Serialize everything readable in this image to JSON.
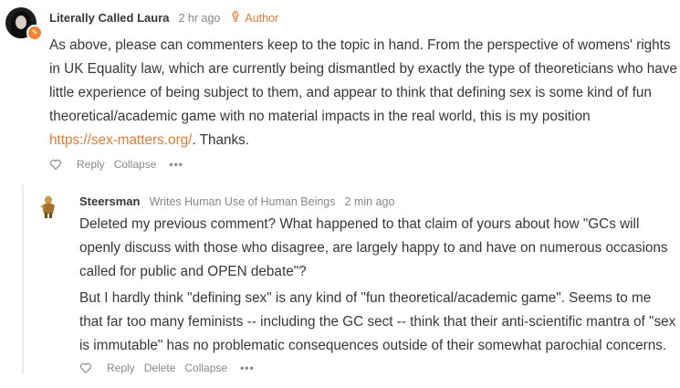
{
  "comment1": {
    "author": "Literally Called Laura",
    "time": "2 hr ago",
    "role_label": "Author",
    "paragraph1": "As above, please can commenters keep to the topic in hand. From the perspective of womens' rights in UK Equality law, which are currently being dismantled by exactly the type of theoreticians who have little experience of being subject to them, and appear to think that defining sex is some kind of fun theoretical/academic game with no material impacts in the real world, this is my position",
    "link": "https://sex-matters.org/",
    "link_suffix": ". Thanks.",
    "actions": {
      "reply": "Reply",
      "collapse": "Collapse",
      "more": "•••"
    }
  },
  "comment2": {
    "author": "Steersman",
    "subtitle": "Writes Human Use of Human Beings",
    "time": "2 min ago",
    "paragraph1": "Deleted my previous comment? What happened to that claim of yours about how \"GCs will openly discuss with those who disagree, are largely happy to and have on numerous occasions called for public and OPEN debate\"?",
    "paragraph2": "But I hardly think \"defining sex\" is any kind of \"fun theoretical/academic game\". Seems to me that far too many feminists -- including the GC sect -- think that their anti-scientific mantra of \"sex is immutable\" has no problematic consequences outside of their somewhat parochial concerns.",
    "actions": {
      "reply": "Reply",
      "delete": "Delete",
      "collapse": "Collapse",
      "more": "•••"
    }
  },
  "colors": {
    "accent": "#e07a33",
    "text": "#363737",
    "meta": "#868787"
  }
}
